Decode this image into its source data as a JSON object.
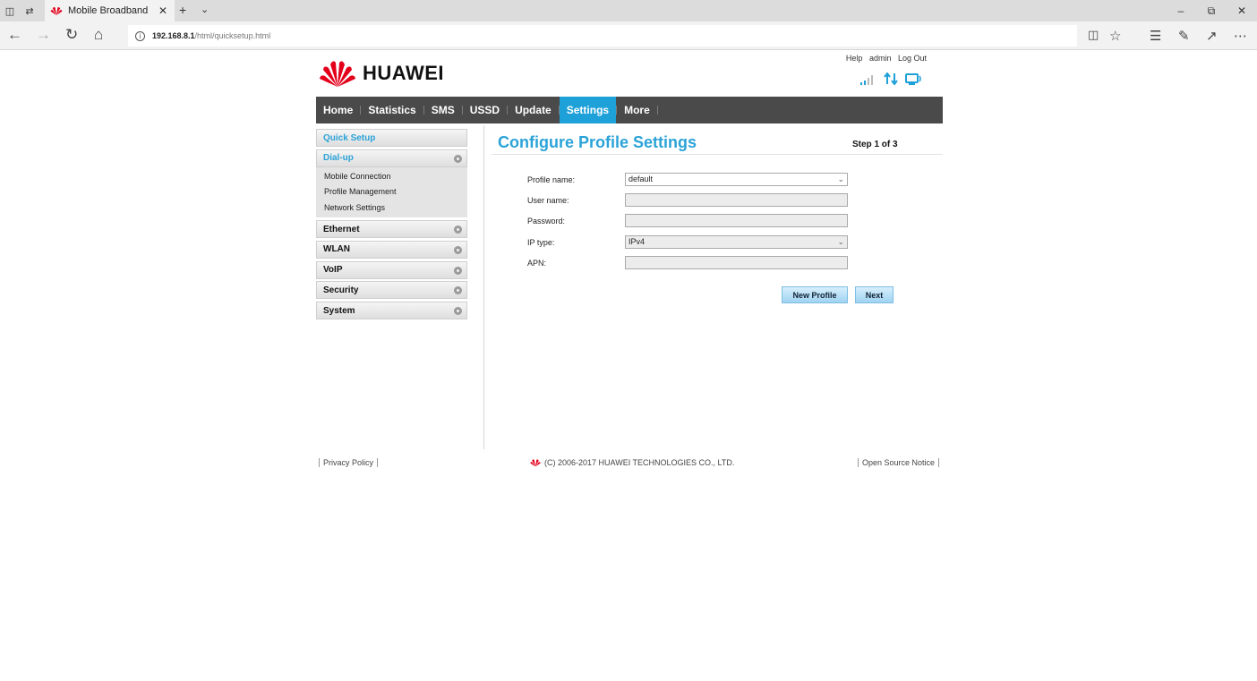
{
  "browser": {
    "tab_title": "Mobile Broadband",
    "url_host": "192.168.8.1",
    "url_path": "/html/quicksetup.html"
  },
  "header": {
    "brand": "HUAWEI",
    "links": [
      "Help",
      "admin",
      "Log Out"
    ]
  },
  "main_nav": {
    "items": [
      {
        "label": "Home"
      },
      {
        "label": "Statistics"
      },
      {
        "label": "SMS"
      },
      {
        "label": "USSD"
      },
      {
        "label": "Update"
      },
      {
        "label": "Settings",
        "active": true
      },
      {
        "label": "More"
      }
    ]
  },
  "sidebar": {
    "quick_setup": "Quick Setup",
    "dialup": "Dial-up",
    "dialup_sub": [
      "Mobile Connection",
      "Profile Management",
      "Network Settings"
    ],
    "sections": [
      "Ethernet",
      "WLAN",
      "VoIP",
      "Security",
      "System"
    ]
  },
  "content": {
    "title": "Configure Profile Settings",
    "step": "Step 1 of 3",
    "fields": {
      "profile_name_label": "Profile name:",
      "profile_name_value": "default",
      "user_name_label": "User name:",
      "user_name_value": "",
      "password_label": "Password:",
      "password_value": "",
      "ip_type_label": "IP type:",
      "ip_type_value": "IPv4",
      "apn_label": "APN:",
      "apn_value": ""
    },
    "new_profile_button": "New Profile",
    "next_button": "Next"
  },
  "footer": {
    "privacy": "Privacy Policy",
    "copyright": "(C) 2006-2017 HUAWEI TECHNOLOGIES CO., LTD.",
    "open_source": "Open Source Notice"
  },
  "colors": {
    "accent": "#1ea1d8",
    "title_blue": "#2ba3d8",
    "nav_bg": "#4a4a4a",
    "brand_red": "#e4001b"
  }
}
